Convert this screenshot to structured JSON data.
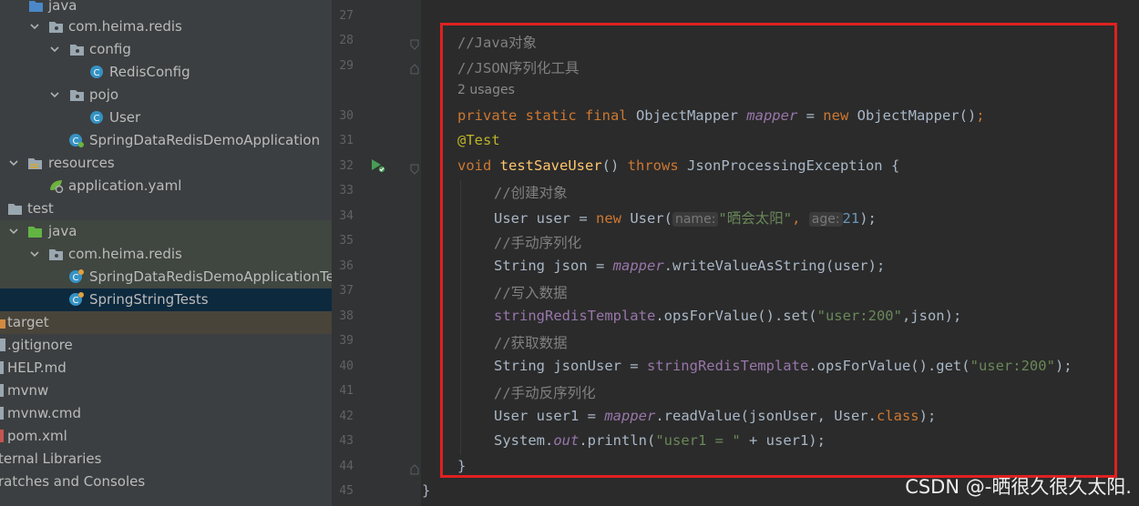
{
  "project_tree": {
    "items": [
      {
        "label": "java",
        "icon": "folder-icon"
      },
      {
        "label": "com.heima.redis",
        "icon": "package-icon"
      },
      {
        "label": "config",
        "icon": "package-icon"
      },
      {
        "label": "RedisConfig",
        "icon": "class-icon"
      },
      {
        "label": "pojo",
        "icon": "package-icon"
      },
      {
        "label": "User",
        "icon": "class-icon"
      },
      {
        "label": "SpringDataRedisDemoApplication",
        "icon": "spring-class-icon"
      },
      {
        "label": "resources",
        "icon": "resources-folder-icon"
      },
      {
        "label": "application.yaml",
        "icon": "yaml-spring-icon"
      },
      {
        "label": "test",
        "icon": "folder-icon"
      },
      {
        "label": "java",
        "icon": "test-folder-icon"
      },
      {
        "label": "com.heima.redis",
        "icon": "package-icon"
      },
      {
        "label": "SpringDataRedisDemoApplicationTe",
        "icon": "spring-class-icon"
      },
      {
        "label": "SpringStringTests",
        "icon": "spring-class-icon"
      },
      {
        "label": "target",
        "icon": "folder-icon"
      },
      {
        "label": ".gitignore",
        "icon": "file-icon"
      },
      {
        "label": "HELP.md",
        "icon": "markdown-file-icon"
      },
      {
        "label": "mvnw",
        "icon": "file-icon"
      },
      {
        "label": "mvnw.cmd",
        "icon": "file-icon"
      },
      {
        "label": "pom.xml",
        "icon": "maven-file-icon"
      },
      {
        "label": "ternal Libraries",
        "icon": "library-icon"
      },
      {
        "label": "ratches and Consoles",
        "icon": "scratch-icon"
      }
    ]
  },
  "editor": {
    "line_numbers": [
      "27",
      "28",
      "29",
      "30",
      "31",
      "32",
      "33",
      "34",
      "35",
      "36",
      "37",
      "38",
      "39",
      "40",
      "41",
      "42",
      "43",
      "44",
      "45"
    ],
    "usages_hint": "2 usages",
    "code": {
      "c1": "//Java对象",
      "c2": "//JSON序列化工具",
      "l30": {
        "k1": "private static final",
        "t": " ObjectMapper ",
        "f": "mapper",
        "eq": " = ",
        "k2": "new",
        "r": " ObjectMapper()",
        "s": ";"
      },
      "l31": "@Test",
      "l32": {
        "k1": "void",
        "fn": "testSaveUser",
        "mid": "() ",
        "k2": "throws",
        "r": " JsonProcessingException {"
      },
      "c3": "//创建对象",
      "l34": {
        "a": "User user = ",
        "k": "new",
        "b": " User(",
        "h1": "name:",
        "s1": "\"晒会太阳\"",
        "comma": ", ",
        "h2": "age:",
        "n": "21",
        "e": ");"
      },
      "c4": "//手动序列化",
      "l36": {
        "a": "String json = ",
        "f": "mapper",
        "b": ".writeValueAsString(user);"
      },
      "c5": "//写入数据",
      "l38": {
        "f": "stringRedisTemplate",
        "b": ".opsForValue().set(",
        "s": "\"user:200\"",
        "e": ",json);"
      },
      "c6": "//获取数据",
      "l40": {
        "a": "String jsonUser = ",
        "f": "stringRedisTemplate",
        "b": ".opsForValue().get(",
        "s": "\"user:200\"",
        "e": ");"
      },
      "c7": "//手动反序列化",
      "l42": {
        "a": "User user1 = ",
        "f": "mapper",
        "b": ".readValue(jsonUser, User.",
        "k": "class",
        "e": ");"
      },
      "l43": {
        "a": "System.",
        "f": "out",
        "b": ".println(",
        "s": "\"user1 = \"",
        "e": " + user1);"
      },
      "l44": "}",
      "l45": "}"
    }
  },
  "annotation_box_color": "#e02020",
  "watermark": "CSDN @-晒很久很久太阳."
}
